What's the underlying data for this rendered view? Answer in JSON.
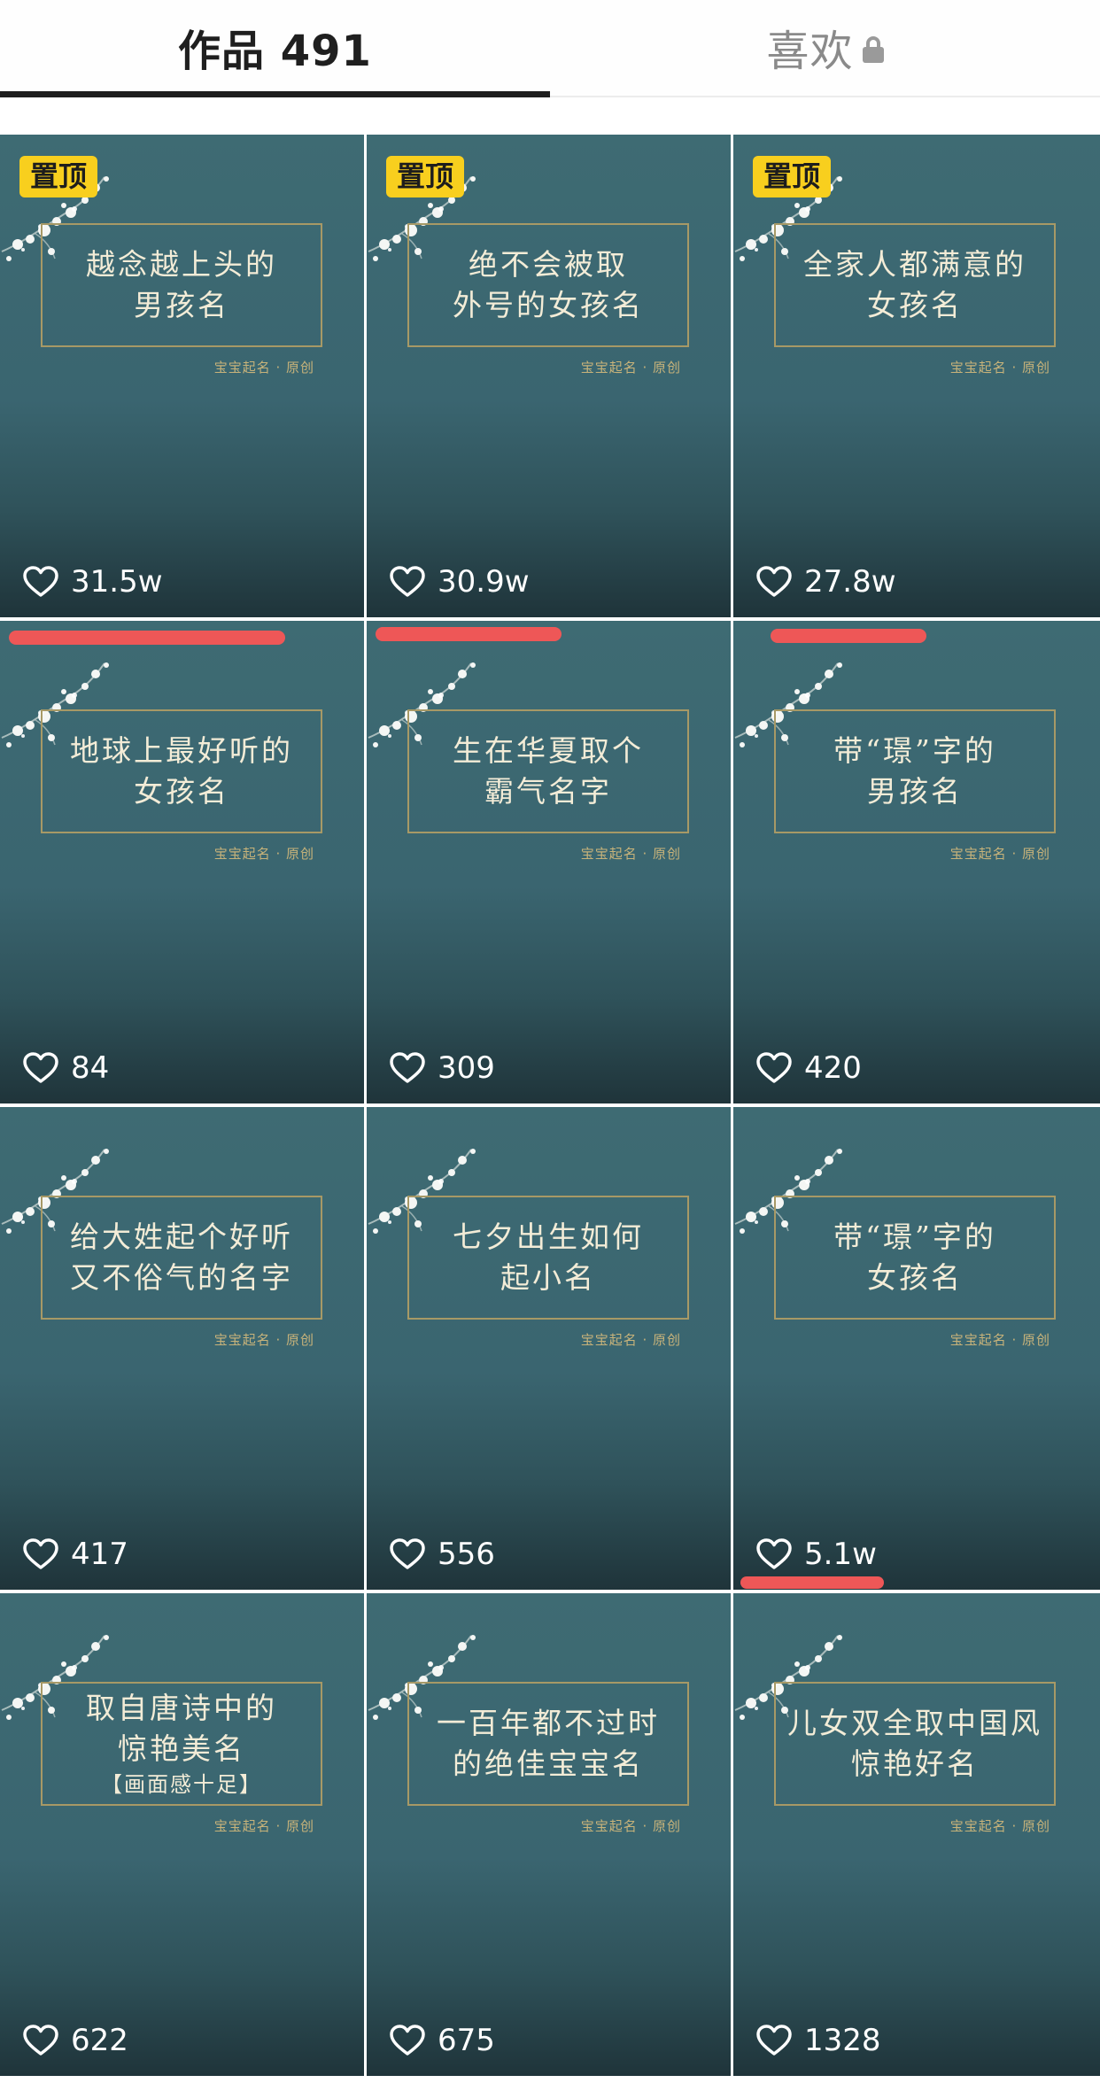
{
  "tabs": {
    "works_label": "作品 491",
    "likes_label": "喜欢"
  },
  "icons": {
    "lock": "lock-icon",
    "like": "heart-outline-icon"
  },
  "colors": {
    "pin_badge": "#f8cf1e",
    "annotation_mark": "#ee5757",
    "tile_background": "#3e6b73"
  },
  "videos": [
    {
      "pinned": true,
      "pin_label": "置顶",
      "title_lines": [
        "越念越上头的",
        "男孩名"
      ],
      "brand": "宝宝起名 · 原创",
      "likes": "31.5w"
    },
    {
      "pinned": true,
      "pin_label": "置顶",
      "title_lines": [
        "绝不会被取",
        "外号的女孩名"
      ],
      "brand": "宝宝起名 · 原创",
      "likes": "30.9w"
    },
    {
      "pinned": true,
      "pin_label": "置顶",
      "title_lines": [
        "全家人都满意的",
        "女孩名"
      ],
      "brand": "宝宝起名 · 原创",
      "likes": "27.8w"
    },
    {
      "pinned": false,
      "title_lines": [
        "地球上最好听的",
        "女孩名"
      ],
      "brand": "宝宝起名 · 原创",
      "likes": "84"
    },
    {
      "pinned": false,
      "title_lines": [
        "生在华夏取个",
        "霸气名字"
      ],
      "brand": "宝宝起名 · 原创",
      "likes": "309"
    },
    {
      "pinned": false,
      "title_lines": [
        "带“璟”字的",
        "男孩名"
      ],
      "brand": "宝宝起名 · 原创",
      "likes": "420"
    },
    {
      "pinned": false,
      "title_lines": [
        "给大姓起个好听",
        "又不俗气的名字"
      ],
      "brand": "宝宝起名 · 原创",
      "likes": "417"
    },
    {
      "pinned": false,
      "title_lines": [
        "七夕出生如何",
        "起小名"
      ],
      "brand": "宝宝起名 · 原创",
      "likes": "556"
    },
    {
      "pinned": false,
      "title_lines": [
        "带“璟”字的",
        "女孩名"
      ],
      "brand": "宝宝起名 · 原创",
      "likes": "5.1w"
    },
    {
      "pinned": false,
      "title_lines": [
        "取自唐诗中的",
        "惊艳美名",
        "【画面感十足】"
      ],
      "brand": "宝宝起名 · 原创",
      "likes": "622"
    },
    {
      "pinned": false,
      "title_lines": [
        "一百年都不过时",
        "的绝佳宝宝名"
      ],
      "brand": "宝宝起名 · 原创",
      "likes": "675"
    },
    {
      "pinned": false,
      "title_lines": [
        "儿女双全取中国风",
        "惊艳好名"
      ],
      "brand": "宝宝起名 · 原创",
      "likes": "1328"
    }
  ]
}
